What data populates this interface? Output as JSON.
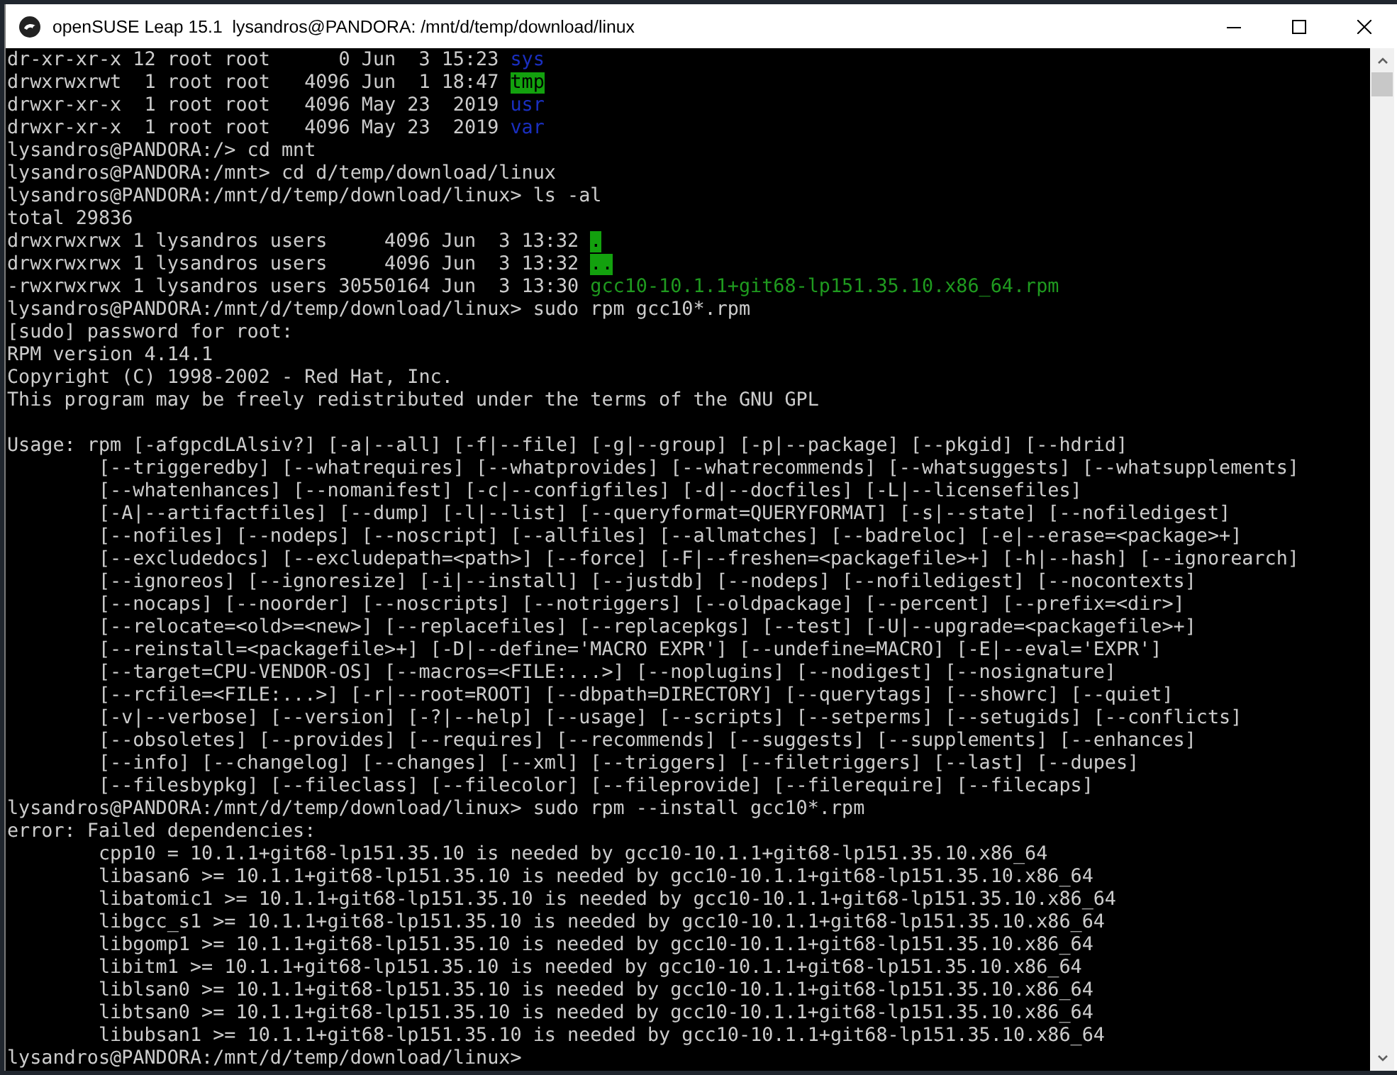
{
  "window": {
    "title": "openSUSE Leap 15.1  lysandros@PANDORA: /mnt/d/temp/download/linux"
  },
  "terminal": {
    "lines": [
      {
        "kind": "entry",
        "text": "dr-xr-xr-x 12 root root      0 Jun  3 15:23 ",
        "entry": {
          "text": "sys",
          "kind": "directory"
        }
      },
      {
        "kind": "entry",
        "text": "drwxrwxrwt  1 root root   4096 Jun  1 18:47 ",
        "entry": {
          "text": "tmp",
          "kind": "sticky"
        }
      },
      {
        "kind": "entry",
        "text": "drwxr-xr-x  1 root root   4096 May 23  2019 ",
        "entry": {
          "text": "usr",
          "kind": "directory"
        }
      },
      {
        "kind": "entry",
        "text": "drwxr-xr-x  1 root root   4096 May 23  2019 ",
        "entry": {
          "text": "var",
          "kind": "directory"
        }
      },
      {
        "kind": "text",
        "text": "lysandros@PANDORA:/> cd mnt"
      },
      {
        "kind": "text",
        "text": "lysandros@PANDORA:/mnt> cd d/temp/download/linux"
      },
      {
        "kind": "text",
        "text": "lysandros@PANDORA:/mnt/d/temp/download/linux> ls -al"
      },
      {
        "kind": "text",
        "text": "total 29836"
      },
      {
        "kind": "entry",
        "text": "drwxrwxrwx 1 lysandros users     4096 Jun  3 13:32 ",
        "entry": {
          "text": ".",
          "kind": "sticky"
        }
      },
      {
        "kind": "entry",
        "text": "drwxrwxrwx 1 lysandros users     4096 Jun  3 13:32 ",
        "entry": {
          "text": "..",
          "kind": "sticky"
        }
      },
      {
        "kind": "entry",
        "text": "-rwxrwxrwx 1 lysandros users 30550164 Jun  3 13:30 ",
        "entry": {
          "text": "gcc10-10.1.1+git68-lp151.35.10.x86_64.rpm",
          "kind": "executable"
        }
      },
      {
        "kind": "text",
        "text": "lysandros@PANDORA:/mnt/d/temp/download/linux> sudo rpm gcc10*.rpm"
      },
      {
        "kind": "text",
        "text": "[sudo] password for root:"
      },
      {
        "kind": "text",
        "text": "RPM version 4.14.1"
      },
      {
        "kind": "text",
        "text": "Copyright (C) 1998-2002 - Red Hat, Inc."
      },
      {
        "kind": "text",
        "text": "This program may be freely redistributed under the terms of the GNU GPL"
      },
      {
        "kind": "blank"
      },
      {
        "kind": "text",
        "text": "Usage: rpm [-afgpcdLAlsiv?] [-a|--all] [-f|--file] [-g|--group] [-p|--package] [--pkgid] [--hdrid]"
      },
      {
        "kind": "text",
        "text": "        [--triggeredby] [--whatrequires] [--whatprovides] [--whatrecommends] [--whatsuggests] [--whatsupplements]"
      },
      {
        "kind": "text",
        "text": "        [--whatenhances] [--nomanifest] [-c|--configfiles] [-d|--docfiles] [-L|--licensefiles]"
      },
      {
        "kind": "text",
        "text": "        [-A|--artifactfiles] [--dump] [-l|--list] [--queryformat=QUERYFORMAT] [-s|--state] [--nofiledigest]"
      },
      {
        "kind": "text",
        "text": "        [--nofiles] [--nodeps] [--noscript] [--allfiles] [--allmatches] [--badreloc] [-e|--erase=<package>+]"
      },
      {
        "kind": "text",
        "text": "        [--excludedocs] [--excludepath=<path>] [--force] [-F|--freshen=<packagefile>+] [-h|--hash] [--ignorearch]"
      },
      {
        "kind": "text",
        "text": "        [--ignoreos] [--ignoresize] [-i|--install] [--justdb] [--nodeps] [--nofiledigest] [--nocontexts]"
      },
      {
        "kind": "text",
        "text": "        [--nocaps] [--noorder] [--noscripts] [--notriggers] [--oldpackage] [--percent] [--prefix=<dir>]"
      },
      {
        "kind": "text",
        "text": "        [--relocate=<old>=<new>] [--replacefiles] [--replacepkgs] [--test] [-U|--upgrade=<packagefile>+]"
      },
      {
        "kind": "text",
        "text": "        [--reinstall=<packagefile>+] [-D|--define='MACRO EXPR'] [--undefine=MACRO] [-E|--eval='EXPR']"
      },
      {
        "kind": "text",
        "text": "        [--target=CPU-VENDOR-OS] [--macros=<FILE:...>] [--noplugins] [--nodigest] [--nosignature]"
      },
      {
        "kind": "text",
        "text": "        [--rcfile=<FILE:...>] [-r|--root=ROOT] [--dbpath=DIRECTORY] [--querytags] [--showrc] [--quiet]"
      },
      {
        "kind": "text",
        "text": "        [-v|--verbose] [--version] [-?|--help] [--usage] [--scripts] [--setperms] [--setugids] [--conflicts]"
      },
      {
        "kind": "text",
        "text": "        [--obsoletes] [--provides] [--requires] [--recommends] [--suggests] [--supplements] [--enhances]"
      },
      {
        "kind": "text",
        "text": "        [--info] [--changelog] [--changes] [--xml] [--triggers] [--filetriggers] [--last] [--dupes]"
      },
      {
        "kind": "text",
        "text": "        [--filesbypkg] [--fileclass] [--filecolor] [--fileprovide] [--filerequire] [--filecaps]"
      },
      {
        "kind": "text",
        "text": "lysandros@PANDORA:/mnt/d/temp/download/linux> sudo rpm --install gcc10*.rpm"
      },
      {
        "kind": "text",
        "text": "error: Failed dependencies:"
      },
      {
        "kind": "text",
        "text": "        cpp10 = 10.1.1+git68-lp151.35.10 is needed by gcc10-10.1.1+git68-lp151.35.10.x86_64"
      },
      {
        "kind": "text",
        "text": "        libasan6 >= 10.1.1+git68-lp151.35.10 is needed by gcc10-10.1.1+git68-lp151.35.10.x86_64"
      },
      {
        "kind": "text",
        "text": "        libatomic1 >= 10.1.1+git68-lp151.35.10 is needed by gcc10-10.1.1+git68-lp151.35.10.x86_64"
      },
      {
        "kind": "text",
        "text": "        libgcc_s1 >= 10.1.1+git68-lp151.35.10 is needed by gcc10-10.1.1+git68-lp151.35.10.x86_64"
      },
      {
        "kind": "text",
        "text": "        libgomp1 >= 10.1.1+git68-lp151.35.10 is needed by gcc10-10.1.1+git68-lp151.35.10.x86_64"
      },
      {
        "kind": "text",
        "text": "        libitm1 >= 10.1.1+git68-lp151.35.10 is needed by gcc10-10.1.1+git68-lp151.35.10.x86_64"
      },
      {
        "kind": "text",
        "text": "        liblsan0 >= 10.1.1+git68-lp151.35.10 is needed by gcc10-10.1.1+git68-lp151.35.10.x86_64"
      },
      {
        "kind": "text",
        "text": "        libtsan0 >= 10.1.1+git68-lp151.35.10 is needed by gcc10-10.1.1+git68-lp151.35.10.x86_64"
      },
      {
        "kind": "text",
        "text": "        libubsan1 >= 10.1.1+git68-lp151.35.10 is needed by gcc10-10.1.1+git68-lp151.35.10.x86_64"
      },
      {
        "kind": "text",
        "text": "lysandros@PANDORA:/mnt/d/temp/download/linux>"
      }
    ]
  }
}
